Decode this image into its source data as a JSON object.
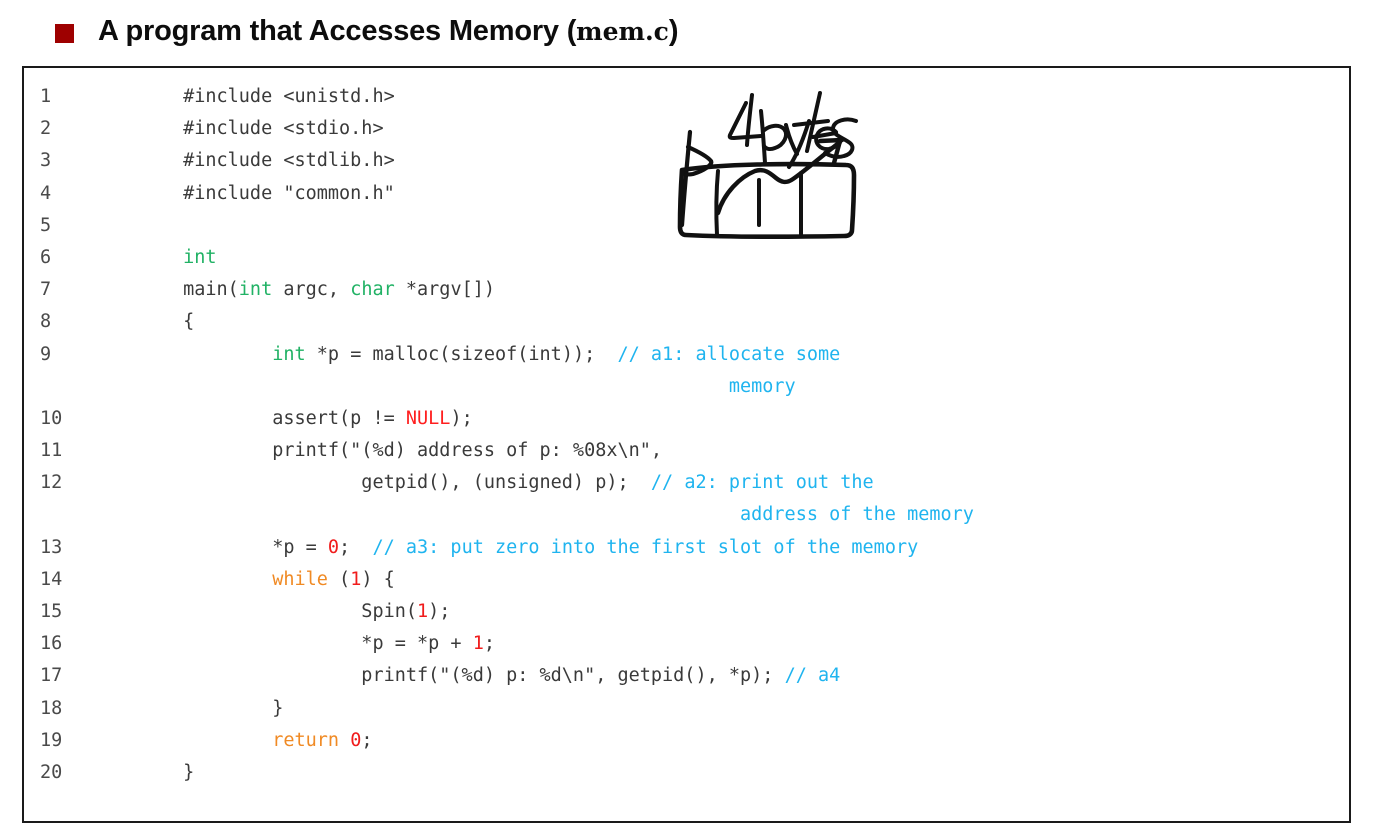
{
  "slide": {
    "title_prefix": "A program that Accesses Memory (",
    "title_mono": "mem.c",
    "title_suffix": ")",
    "bullet_color": "#9e0000"
  },
  "colors": {
    "keyword_type": "#21b265",
    "keyword_control": "#f08a24",
    "number": "#f01c1c",
    "macro": "#ff1f1f",
    "comment": "#1fb4ef",
    "plain": "#3a3a3a",
    "line_number": "#4a4a4a",
    "box_border": "#1a1a1a",
    "background": "#ffffff",
    "ink": "#111111"
  },
  "code": {
    "language": "c",
    "filename": "mem.c",
    "lines": [
      {
        "n": "1",
        "tokens": [
          {
            "t": "plain",
            "s": "        #include <unistd.h>"
          }
        ]
      },
      {
        "n": "2",
        "tokens": [
          {
            "t": "plain",
            "s": "        #include <stdio.h>"
          }
        ]
      },
      {
        "n": "3",
        "tokens": [
          {
            "t": "plain",
            "s": "        #include <stdlib.h>"
          }
        ]
      },
      {
        "n": "4",
        "tokens": [
          {
            "t": "plain",
            "s": "        #include \"common.h\""
          }
        ]
      },
      {
        "n": "5",
        "tokens": [
          {
            "t": "plain",
            "s": ""
          }
        ]
      },
      {
        "n": "6",
        "tokens": [
          {
            "t": "plain",
            "s": "        "
          },
          {
            "t": "kw",
            "s": "int"
          }
        ]
      },
      {
        "n": "7",
        "tokens": [
          {
            "t": "plain",
            "s": "        main("
          },
          {
            "t": "kw",
            "s": "int"
          },
          {
            "t": "plain",
            "s": " argc, "
          },
          {
            "t": "kw",
            "s": "char"
          },
          {
            "t": "plain",
            "s": " *argv[])"
          }
        ]
      },
      {
        "n": "8",
        "tokens": [
          {
            "t": "plain",
            "s": "        {"
          }
        ]
      },
      {
        "n": "9",
        "tokens": [
          {
            "t": "plain",
            "s": "                "
          },
          {
            "t": "kw",
            "s": "int"
          },
          {
            "t": "plain",
            "s": " *p = malloc(sizeof(int));  "
          },
          {
            "t": "cmt",
            "s": "// a1: allocate some"
          }
        ]
      },
      {
        "n": "",
        "tokens": [
          {
            "t": "cmt",
            "s": "                                                         memory"
          }
        ]
      },
      {
        "n": "10",
        "tokens": [
          {
            "t": "plain",
            "s": "                assert(p != "
          },
          {
            "t": "macro",
            "s": "NULL"
          },
          {
            "t": "plain",
            "s": ");"
          }
        ]
      },
      {
        "n": "11",
        "tokens": [
          {
            "t": "plain",
            "s": "                printf(\"(%d) address of p: %08x\\n\","
          }
        ]
      },
      {
        "n": "12",
        "tokens": [
          {
            "t": "plain",
            "s": "                        getpid(), (unsigned) p);  "
          },
          {
            "t": "cmt",
            "s": "// a2: print out the"
          }
        ]
      },
      {
        "n": "",
        "tokens": [
          {
            "t": "cmt",
            "s": "                                                          address of the memory"
          }
        ]
      },
      {
        "n": "13",
        "tokens": [
          {
            "t": "plain",
            "s": "                *p = "
          },
          {
            "t": "num",
            "s": "0"
          },
          {
            "t": "plain",
            "s": ";  "
          },
          {
            "t": "cmt",
            "s": "// a3: put zero into the first slot of the memory"
          }
        ]
      },
      {
        "n": "14",
        "tokens": [
          {
            "t": "plain",
            "s": "                "
          },
          {
            "t": "ctrl",
            "s": "while"
          },
          {
            "t": "plain",
            "s": " ("
          },
          {
            "t": "num",
            "s": "1"
          },
          {
            "t": "plain",
            "s": ") {"
          }
        ]
      },
      {
        "n": "15",
        "tokens": [
          {
            "t": "plain",
            "s": "                        Spin("
          },
          {
            "t": "num",
            "s": "1"
          },
          {
            "t": "plain",
            "s": ");"
          }
        ]
      },
      {
        "n": "16",
        "tokens": [
          {
            "t": "plain",
            "s": "                        *p = *p + "
          },
          {
            "t": "num",
            "s": "1"
          },
          {
            "t": "plain",
            "s": ";"
          }
        ]
      },
      {
        "n": "17",
        "tokens": [
          {
            "t": "plain",
            "s": "                        printf(\"(%d) p: %d\\n\", getpid(), *p); "
          },
          {
            "t": "cmt",
            "s": "// a4"
          }
        ]
      },
      {
        "n": "18",
        "tokens": [
          {
            "t": "plain",
            "s": "                }"
          }
        ]
      },
      {
        "n": "19",
        "tokens": [
          {
            "t": "plain",
            "s": "                "
          },
          {
            "t": "ctrl",
            "s": "return"
          },
          {
            "t": "plain",
            "s": " "
          },
          {
            "t": "num",
            "s": "0"
          },
          {
            "t": "plain",
            "s": ";"
          }
        ]
      },
      {
        "n": "20",
        "tokens": [
          {
            "t": "plain",
            "s": "        }"
          }
        ]
      }
    ]
  },
  "annotation": {
    "pointer_label": "p",
    "size_label": "4 bytes",
    "box_cells": 4,
    "description": "hand-drawn pointer p with curved arrow to a 4-cell memory box labelled 4 bytes"
  }
}
